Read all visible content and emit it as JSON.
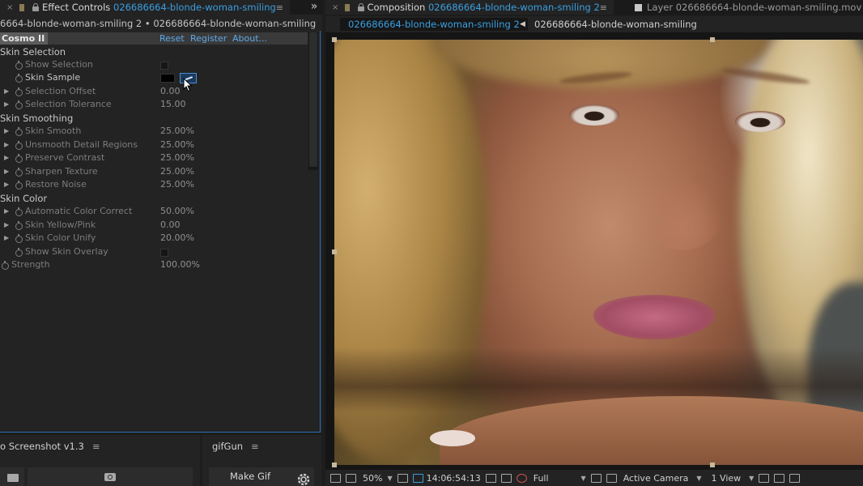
{
  "effect_controls": {
    "tab": {
      "close": "×",
      "title_prefix": "Effect Controls ",
      "title_layer": "026686664-blonde-woman-smiling",
      "menu": "≡",
      "overflow": "»"
    },
    "breadcrumb": "6664-blonde-woman-smiling 2 • 026686664-blonde-woman-smiling",
    "effect": {
      "name": "Cosmo II",
      "reset": "Reset",
      "register": "Register",
      "about": "About..."
    },
    "groups": [
      {
        "title": "Skin Selection"
      },
      {
        "title": "Skin Smoothing"
      },
      {
        "title": "Skin Color"
      }
    ],
    "properties": {
      "show_selection": {
        "label": "Show Selection"
      },
      "skin_sample": {
        "label": "Skin Sample"
      },
      "selection_offset": {
        "label": "Selection Offset",
        "value": "0.00"
      },
      "selection_tolerance": {
        "label": "Selection Tolerance",
        "value": "15.00"
      },
      "skin_smooth": {
        "label": "Skin Smooth",
        "value": "25.00%"
      },
      "unsmooth_detail": {
        "label": "Unsmooth Detail Regions",
        "value": "25.00%"
      },
      "preserve_contrast": {
        "label": "Preserve Contrast",
        "value": "25.00%"
      },
      "sharpen_texture": {
        "label": "Sharpen Texture",
        "value": "25.00%"
      },
      "restore_noise": {
        "label": "Restore Noise",
        "value": "25.00%"
      },
      "auto_color": {
        "label": "Automatic Color Correct",
        "value": "50.00%"
      },
      "skin_yellow_pink": {
        "label": "Skin Yellow/Pink",
        "value": "0.00"
      },
      "skin_color_unify": {
        "label": "Skin Color Unify",
        "value": "20.00%"
      },
      "show_skin_overlay": {
        "label": "Show Skin Overlay"
      },
      "strength": {
        "label": "Strength",
        "value": "100.00%"
      }
    }
  },
  "screenshot_panel": {
    "title": "o Screenshot v1.3",
    "menu": "≡"
  },
  "gifgun_panel": {
    "title": "gifGun",
    "menu": "≡",
    "make_gif": "Make Gif"
  },
  "composition": {
    "tab": {
      "close": "×",
      "title_prefix": "Composition ",
      "title_comp": "026686664-blonde-woman-smiling 2",
      "menu": "≡"
    },
    "layer_tab": {
      "title": "Layer 026686664-blonde-woman-smiling.mov"
    },
    "crumb_active": "026686664-blonde-woman-smiling 2",
    "crumb_next": "026686664-blonde-woman-smiling",
    "footer": {
      "zoom": "50%",
      "timecode": "14:06:54:13",
      "resolution": "Full",
      "camera": "Active Camera",
      "views": "1 View"
    }
  },
  "colors": {
    "accent_blue": "#3b9fe0",
    "link_blue": "#5ea8e8",
    "panel_bg": "#232323",
    "focus_border": "#2d6fb3"
  }
}
